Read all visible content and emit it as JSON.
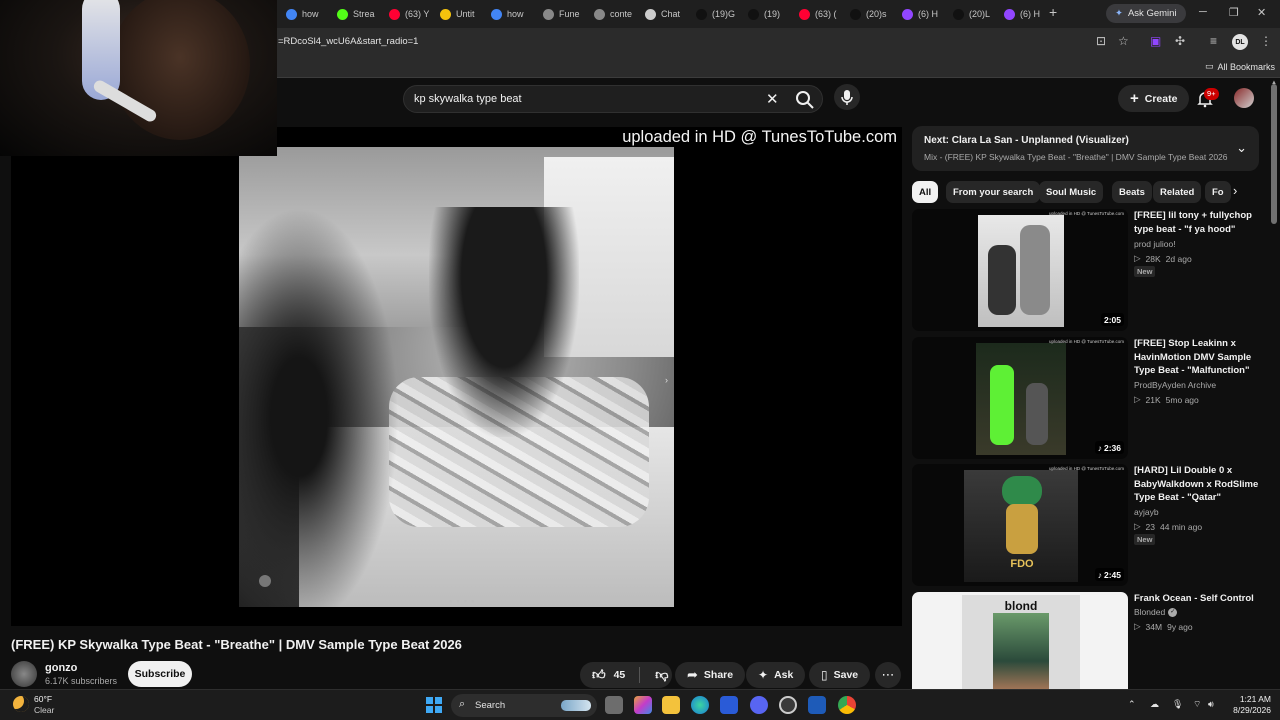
{
  "browser": {
    "tabs": [
      {
        "label": "how",
        "icon": "google-icon",
        "color": "#4285f4"
      },
      {
        "label": "Strea",
        "icon": "kick-icon",
        "color": "#53fc18"
      },
      {
        "label": "(63) Y",
        "icon": "youtube-icon",
        "color": "#ff0033"
      },
      {
        "label": "Untit",
        "icon": "docs-icon",
        "color": "#f4c20d"
      },
      {
        "label": "how",
        "icon": "google-icon",
        "color": "#4285f4"
      },
      {
        "label": "Fune",
        "icon": "web-icon",
        "color": "#888888"
      },
      {
        "label": "conte",
        "icon": "web-icon",
        "color": "#888888"
      },
      {
        "label": "Chat",
        "icon": "chatgpt-icon",
        "color": "#cccccc"
      },
      {
        "label": "(19)G",
        "icon": "tiktok-icon",
        "color": "#111111"
      },
      {
        "label": "(19)",
        "icon": "tiktok-icon",
        "color": "#111111"
      },
      {
        "label": "(63) (",
        "icon": "youtube-icon",
        "color": "#ff0033"
      },
      {
        "label": "(20)s",
        "icon": "tiktok-icon",
        "color": "#111111"
      },
      {
        "label": "(6) H",
        "icon": "twitch-icon",
        "color": "#9146ff"
      },
      {
        "label": "(20)L",
        "icon": "tiktok-icon",
        "color": "#111111"
      },
      {
        "label": "(6) H",
        "icon": "twitch-icon",
        "color": "#9146ff"
      }
    ],
    "ask_gemini": "Ask Gemini",
    "url": "=RDcoSl4_wcU6A&start_radio=1",
    "profile_initials": "DL",
    "all_bookmarks": "All Bookmarks"
  },
  "youtube": {
    "search_query": "kp skywalka type beat",
    "create_label": "Create",
    "notification_count": "9+",
    "player": {
      "watermark": "uploaded in HD @ TunesToTube.com"
    },
    "video": {
      "title": "(FREE) KP Skywalka Type Beat - \"Breathe\" | DMV Sample Type Beat 2026",
      "channel": "gonzo",
      "subscribers": "6.17K subscribers",
      "subscribe_label": "Subscribe",
      "likes": "45",
      "share_label": "Share",
      "ask_label": "Ask",
      "save_label": "Save"
    },
    "next_up": {
      "title": "Next: Clara La San - Unplanned (Visualizer)",
      "subtitle": "Mix - (FREE) KP Skywalka Type Beat - \"Breathe\" | DMV Sample Type Beat 2026"
    },
    "chips": [
      "All",
      "From your search",
      "Soul Music",
      "Beats",
      "Related",
      "Fo"
    ],
    "recommendations": [
      {
        "title": "[FREE] lil tony + fullychop type beat - \"f ya hood\"",
        "channel": "prod julioo!",
        "views": "28K",
        "age": "2d ago",
        "duration": "2:05",
        "badge": "New",
        "verified": false
      },
      {
        "title": "[FREE] Stop Leakinn x HavinMotion DMV Sample Type Beat - \"Malfunction\"",
        "channel": "ProdByAyden Archive",
        "views": "21K",
        "age": "5mo ago",
        "duration": "2:36",
        "badge": "",
        "verified": false
      },
      {
        "title": "[HARD] Lil Double 0 x BabyWalkdown x RodSlime Type Beat - \"Qatar\"",
        "channel": "ayjayb",
        "views": "23",
        "age": "44 min ago",
        "duration": "2:45",
        "badge": "New",
        "verified": false
      },
      {
        "title": "Frank Ocean - Self Control",
        "channel": "Blonded",
        "views": "34M",
        "age": "9y ago",
        "duration": "",
        "badge": "",
        "verified": true
      }
    ],
    "thumb_watermark": "uploaded in HD @ TunesToTube.com",
    "blond_word": "blond"
  },
  "taskbar": {
    "temperature": "60°F",
    "condition": "Clear",
    "search_label": "Search",
    "time": "1:21 AM",
    "date": "8/29/2026"
  }
}
